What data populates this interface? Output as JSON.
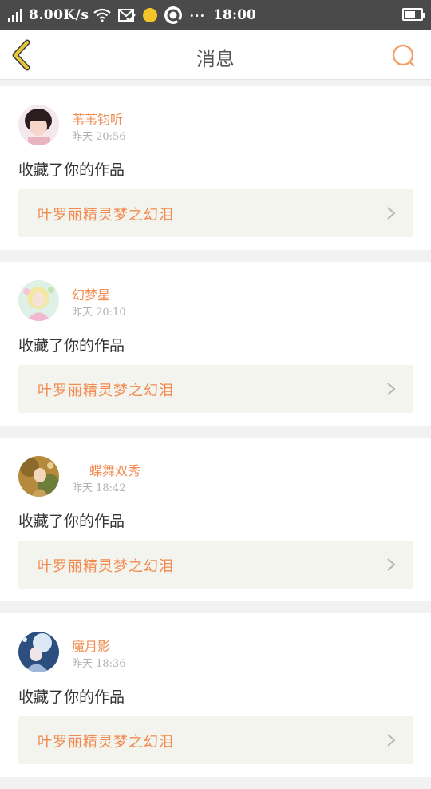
{
  "status_bar": {
    "net_speed": "8.00K/s",
    "time": "18:00",
    "more": "···"
  },
  "header": {
    "title": "消息",
    "back_icon": "chevron-left-icon",
    "search_icon": "search-icon"
  },
  "messages": [
    {
      "username": "苇苇钧听",
      "time": "昨天 20:56",
      "action": "收藏了你的作品",
      "work_title": "叶罗丽精灵梦之幻泪"
    },
    {
      "username": "幻梦星",
      "time": "昨天 20:10",
      "action": "收藏了你的作品",
      "work_title": "叶罗丽精灵梦之幻泪"
    },
    {
      "username": "蝶舞双秀",
      "time": "昨天 18:42",
      "action": "收藏了你的作品",
      "work_title": "叶罗丽精灵梦之幻泪"
    },
    {
      "username": "魔月影",
      "time": "昨天 18:36",
      "action": "收藏了你的作品",
      "work_title": "叶罗丽精灵梦之幻泪"
    }
  ],
  "colors": {
    "accent": "#f08a50",
    "back_arrow": "#e8c83a",
    "status_bar_bg": "#4a4a4a",
    "work_bg": "#f4f4ee"
  }
}
